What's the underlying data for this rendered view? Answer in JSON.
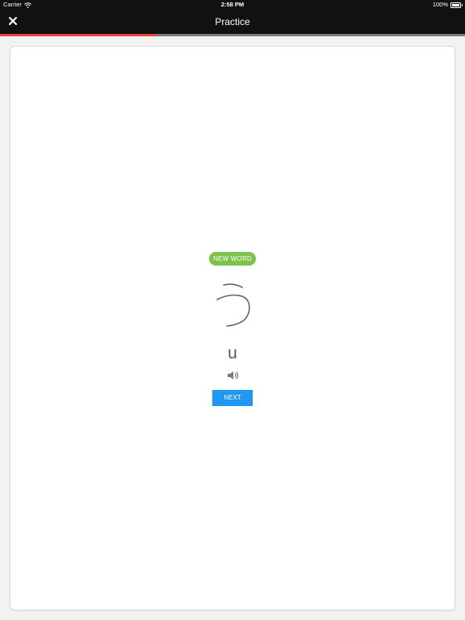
{
  "status_bar": {
    "carrier": "Carrier",
    "time": "2:58 PM",
    "battery": "100%",
    "wifi_icon": "wifi-icon",
    "battery_icon": "battery-icon"
  },
  "nav": {
    "title": "Practice",
    "close_icon": "close-icon"
  },
  "progress": {
    "fraction": 0.335,
    "fill_color": "#e8453c",
    "track_color": "#7a7a7a"
  },
  "card": {
    "badge": "NEW WORD",
    "badge_color": "#7cc24b",
    "kana": "う",
    "romaji": "u",
    "speaker_icon": "speaker-icon",
    "next_label": "NEXT",
    "next_color": "#2196f3"
  }
}
